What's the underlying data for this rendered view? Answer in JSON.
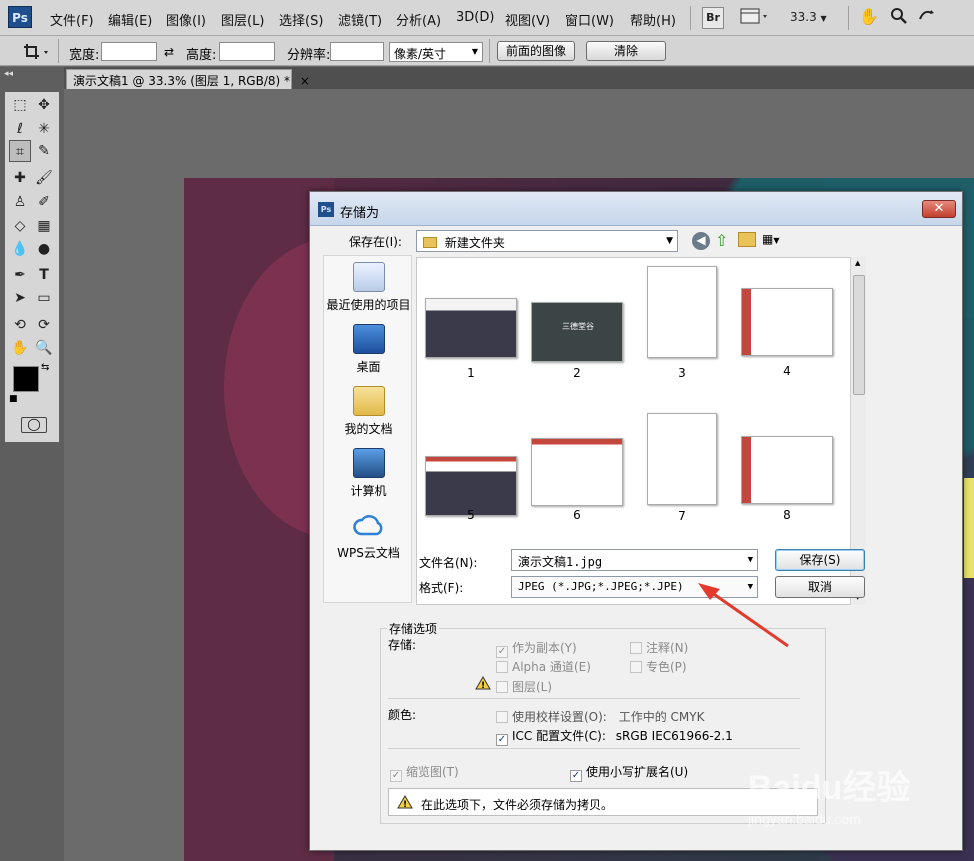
{
  "app": {
    "logo": "Ps"
  },
  "menu": {
    "items": [
      "文件(F)",
      "编辑(E)",
      "图像(I)",
      "图层(L)",
      "选择(S)",
      "滤镜(T)",
      "分析(A)",
      "3D(D)",
      "视图(V)",
      "窗口(W)",
      "帮助(H)"
    ],
    "bridge": "Br",
    "zoom": "33.3"
  },
  "options": {
    "width_label": "宽度:",
    "height_label": "高度:",
    "resolution_label": "分辨率:",
    "unit_select": "像素/英寸",
    "front_image_btn": "前面的图像",
    "clear_btn": "清除"
  },
  "document": {
    "tab_title": "演示文稿1 @ 33.3% (图层 1, RGB/8) *",
    "tab_close": "×"
  },
  "dialog": {
    "title": "存储为",
    "title_icon": "Ps",
    "close": "✕",
    "save_in_label": "保存在(I):",
    "save_in_value": "新建文件夹",
    "places": [
      {
        "label": "最近使用的项目",
        "icon": "recent-icon"
      },
      {
        "label": "桌面",
        "icon": "desktop-icon"
      },
      {
        "label": "我的文档",
        "icon": "documents-icon"
      },
      {
        "label": "计算机",
        "icon": "computer-icon"
      },
      {
        "label": "WPS云文档",
        "icon": "cloud-icon"
      }
    ],
    "files": [
      "1",
      "2",
      "3",
      "4",
      "5",
      "6",
      "7",
      "8"
    ],
    "thumb_text": "三德堂谷",
    "filename_label": "文件名(N):",
    "filename_value": "演示文稿1.jpg",
    "format_label": "格式(F):",
    "format_value": "JPEG (*.JPG;*.JPEG;*.JPE)",
    "save_btn": "保存(S)",
    "cancel_btn": "取消",
    "options_group_label": "存储选项",
    "store_label": "存储:",
    "store_opts": [
      {
        "label": "作为副本(Y)",
        "checked": true,
        "disabled": true
      },
      {
        "label": "注释(N)",
        "checked": false,
        "disabled": true
      },
      {
        "label": "Alpha 通道(E)",
        "checked": false,
        "disabled": true
      },
      {
        "label": "专色(P)",
        "checked": false,
        "disabled": true
      },
      {
        "label": "图层(L)",
        "checked": false,
        "disabled": true
      }
    ],
    "color_label": "颜色:",
    "proof_label": "使用校样设置(O):",
    "proof_value": "工作中的 CMYK",
    "icc_label": "ICC 配置文件(C):",
    "icc_value": "sRGB IEC61966-2.1",
    "thumbnail_label": "缩览图(T)",
    "lowercase_label": "使用小写扩展名(U)",
    "warning_text": "在此选项下，文件必须存储为拷贝。"
  },
  "watermark": {
    "brand": "Baidu经验",
    "url": "jingyan.baidu.com"
  },
  "colors": {
    "accent_arrow": "#e23b2e",
    "ps_blue": "#1f4f8d",
    "dialog_bg": "#f0f0f0"
  }
}
